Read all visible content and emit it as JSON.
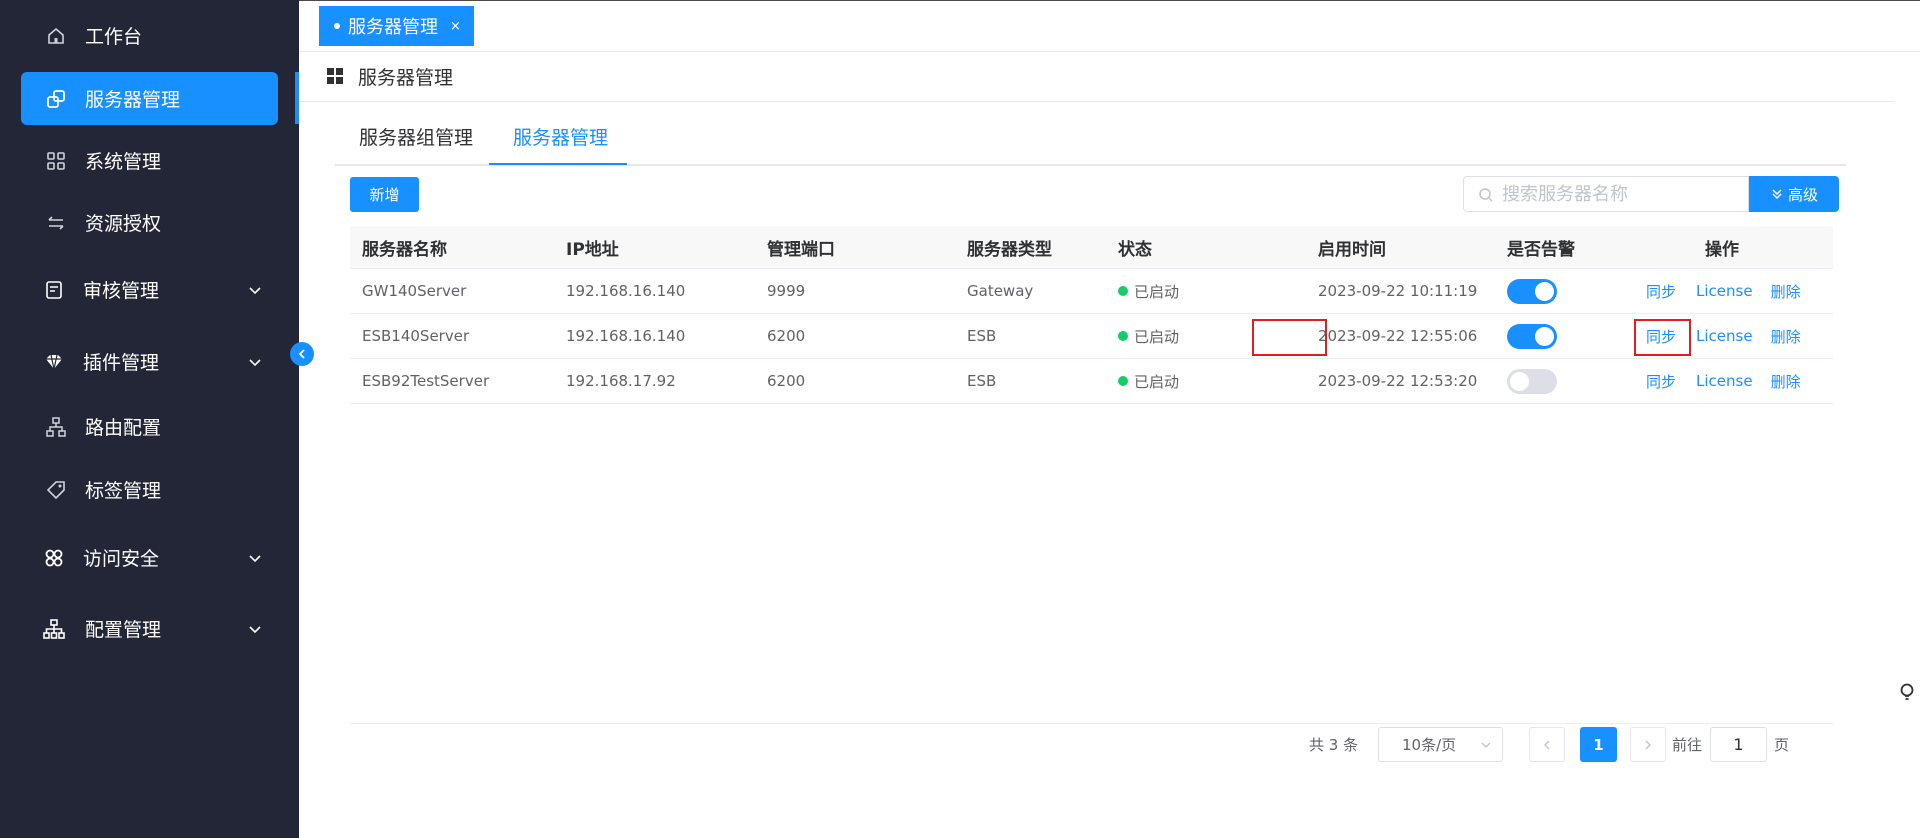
{
  "sidebar": {
    "items": [
      {
        "label": "工作台",
        "icon": "home-icon"
      },
      {
        "label": "服务器管理",
        "icon": "server-icon"
      },
      {
        "label": "系统管理",
        "icon": "apps-grid-icon"
      },
      {
        "label": "资源授权",
        "icon": "transfer-icon"
      },
      {
        "label": "审核管理",
        "icon": "audit-icon"
      },
      {
        "label": "插件管理",
        "icon": "diamond-icon"
      },
      {
        "label": "路由配置",
        "icon": "route-tree-icon"
      },
      {
        "label": "标签管理",
        "icon": "tag-icon"
      },
      {
        "label": "访问安全",
        "icon": "security-icon"
      },
      {
        "label": "配置管理",
        "icon": "config-tree-icon"
      }
    ],
    "active": "服务器管理"
  },
  "tagbar": {
    "tab_label": "服务器管理",
    "close": "×"
  },
  "breadcrumb": {
    "title": "服务器管理"
  },
  "tabs": [
    {
      "label": "服务器组管理"
    },
    {
      "label": "服务器管理"
    }
  ],
  "toolbar": {
    "add_label": "新增",
    "search_placeholder": "搜索服务器名称",
    "advanced_label": "高级"
  },
  "table": {
    "columns": [
      "服务器名称",
      "IP地址",
      "管理端口",
      "服务器类型",
      "状态",
      "启用时间",
      "是否告警",
      "操作"
    ],
    "rows": [
      {
        "name": "GW140Server",
        "ip": "192.168.16.140",
        "port": "9999",
        "type": "Gateway",
        "status": "已启动",
        "time": "2023-09-22 10:11:19",
        "alarm": true
      },
      {
        "name": "ESB140Server",
        "ip": "192.168.16.140",
        "port": "6200",
        "type": "ESB",
        "status": "已启动",
        "time": "2023-09-22 12:55:06",
        "alarm": true
      },
      {
        "name": "ESB92TestServer",
        "ip": "192.168.17.92",
        "port": "6200",
        "type": "ESB",
        "status": "已启动",
        "time": "2023-09-22 12:53:20",
        "alarm": false
      }
    ],
    "ops": {
      "sync": "同步",
      "license": "License",
      "delete": "删除"
    }
  },
  "pagination": {
    "total": "共 3 条",
    "page_size": "10条/页",
    "current": "1",
    "goto_prefix": "前往",
    "goto_value": "1",
    "goto_suffix": "页"
  },
  "colors": {
    "sidebar_bg": "#222636",
    "primary": "#1890ff",
    "status_green": "#13ce66",
    "highlight_red": "#e02020"
  }
}
